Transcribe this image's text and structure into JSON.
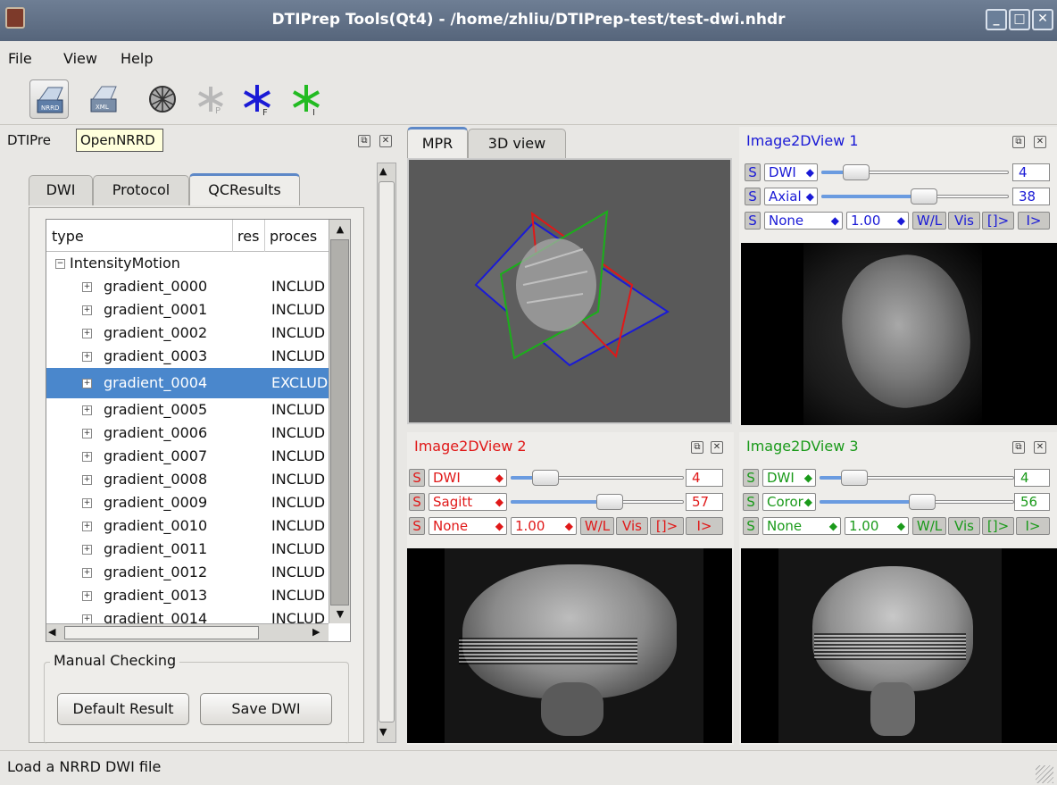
{
  "window": {
    "title": "DTIPrep Tools(Qt4) - /home/zhliu/DTIPrep-test/test-dwi.nhdr"
  },
  "menu": [
    "File",
    "View",
    "Help"
  ],
  "tooltip": "OpenNRRD",
  "dock": {
    "title": "DTIPre",
    "tabs": [
      "DWI",
      "Protocol",
      "QCResults"
    ],
    "tree": {
      "columns": [
        "type",
        "res",
        "proces"
      ],
      "root": "IntensityMotion",
      "rows": [
        {
          "name": "gradient_0000",
          "result": "INCLUD"
        },
        {
          "name": "gradient_0001",
          "result": "INCLUD"
        },
        {
          "name": "gradient_0002",
          "result": "INCLUD"
        },
        {
          "name": "gradient_0003",
          "result": "INCLUD"
        },
        {
          "name": "gradient_0004",
          "result": "EXCLUD"
        },
        {
          "name": "gradient_0005",
          "result": "INCLUD"
        },
        {
          "name": "gradient_0006",
          "result": "INCLUD"
        },
        {
          "name": "gradient_0007",
          "result": "INCLUD"
        },
        {
          "name": "gradient_0008",
          "result": "INCLUD"
        },
        {
          "name": "gradient_0009",
          "result": "INCLUD"
        },
        {
          "name": "gradient_0010",
          "result": "INCLUD"
        },
        {
          "name": "gradient_0011",
          "result": "INCLUD"
        },
        {
          "name": "gradient_0012",
          "result": "INCLUD"
        },
        {
          "name": "gradient_0013",
          "result": "INCLUD"
        },
        {
          "name": "gradient_0014",
          "result": "INCLUD"
        }
      ]
    },
    "manual_checking": {
      "label": "Manual Checking",
      "default_result": "Default Result",
      "save_dwi": "Save DWI"
    }
  },
  "center_tabs": [
    "MPR",
    "3D view"
  ],
  "views": [
    {
      "title": "Image2DView 1",
      "color": "#1a1ad6",
      "s": "S",
      "image": "DWI",
      "image_value": "4",
      "orient": "Axial",
      "orient_value": "38",
      "lut": "None",
      "zoom": "1.00",
      "wl": "W/L",
      "vis": "Vis",
      "b1": "[]>",
      "b2": "I>",
      "slider1": 0.18,
      "slider2": 0.52
    },
    {
      "title": "Image2DView 2",
      "color": "#e01818",
      "s": "S",
      "image": "DWI",
      "image_value": "4",
      "orient": "Sagitt",
      "orient_value": "57",
      "lut": "None",
      "zoom": "1.00",
      "wl": "W/L",
      "vis": "Vis",
      "b1": "[]>",
      "b2": "I>",
      "slider1": 0.18,
      "slider2": 0.56
    },
    {
      "title": "Image2DView 3",
      "color": "#1a9a1a",
      "s": "S",
      "image": "DWI",
      "image_value": "4",
      "orient": "Coror",
      "orient_value": "56",
      "lut": "None",
      "zoom": "1.00",
      "wl": "W/L",
      "vis": "Vis",
      "b1": "[]>",
      "b2": "I>",
      "slider1": 0.18,
      "slider2": 0.52
    }
  ],
  "status": "Load a NRRD DWI file"
}
